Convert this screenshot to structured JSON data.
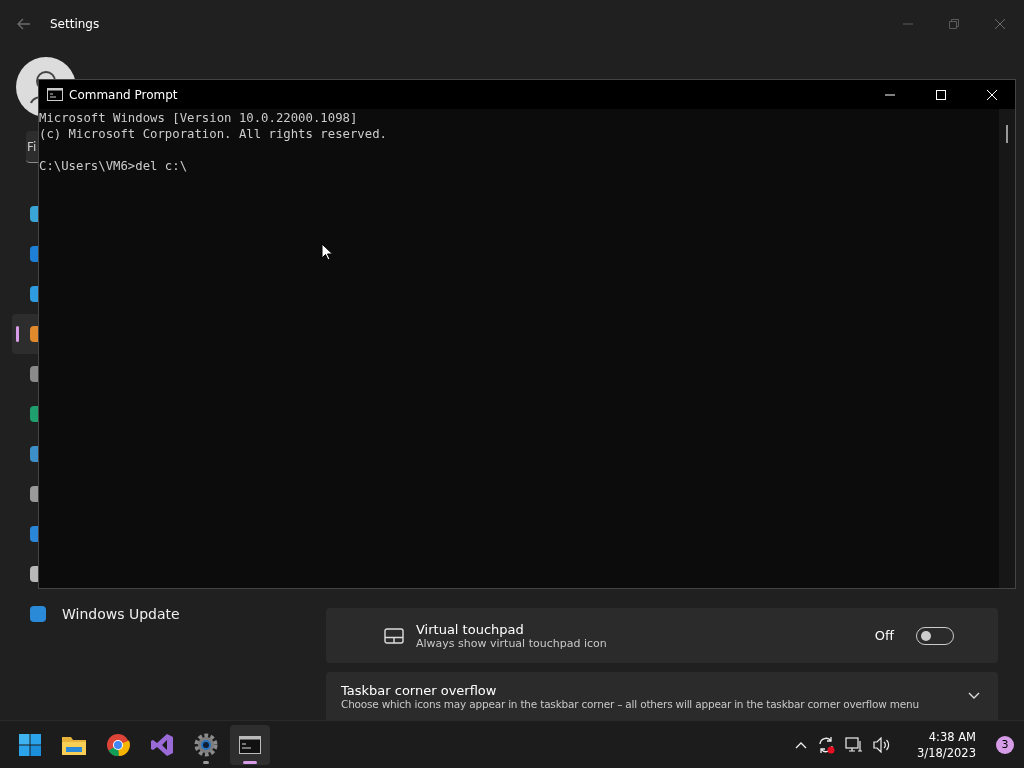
{
  "settings": {
    "title": "Settings",
    "search": {
      "placeholder": "Fi"
    },
    "nav_items": [
      {
        "kind": "system",
        "selected": false
      },
      {
        "kind": "bluetooth",
        "selected": false
      },
      {
        "kind": "network",
        "selected": false
      },
      {
        "kind": "personalization",
        "selected": true
      },
      {
        "kind": "apps",
        "selected": false
      },
      {
        "kind": "accounts",
        "selected": false
      },
      {
        "kind": "time",
        "selected": false
      },
      {
        "kind": "gaming",
        "selected": false
      },
      {
        "kind": "accessibility",
        "selected": false
      },
      {
        "kind": "privacy",
        "selected": false
      },
      {
        "kind": "update",
        "label": "Windows Update",
        "selected": false
      }
    ],
    "rows": [
      {
        "kind": "toggle",
        "title": "Virtual touchpad",
        "description": "Always show virtual touchpad icon",
        "state_label": "Off",
        "on": false
      },
      {
        "kind": "expander",
        "title": "Taskbar corner overflow",
        "description": "Choose which icons may appear in the taskbar corner – all others will appear in the taskbar corner overflow menu",
        "expanded": false
      }
    ]
  },
  "console": {
    "title": "Command Prompt",
    "lines": [
      "Microsoft Windows [Version 10.0.22000.1098]",
      "(c) Microsoft Corporation. All rights reserved."
    ],
    "prompt": "C:\\Users\\VM6>del c:\\"
  },
  "taskbar": {
    "apps": [
      {
        "kind": "start",
        "running": false,
        "selected": false
      },
      {
        "kind": "folder",
        "running": false,
        "selected": false
      },
      {
        "kind": "browser",
        "running": false,
        "selected": false
      },
      {
        "kind": "ide",
        "running": false,
        "selected": false
      },
      {
        "kind": "settings",
        "running": true,
        "selected": false
      },
      {
        "kind": "terminal",
        "running": true,
        "selected": true
      }
    ],
    "time": "4:38 AM",
    "date": "3/18/2023",
    "notification_count": "3"
  }
}
